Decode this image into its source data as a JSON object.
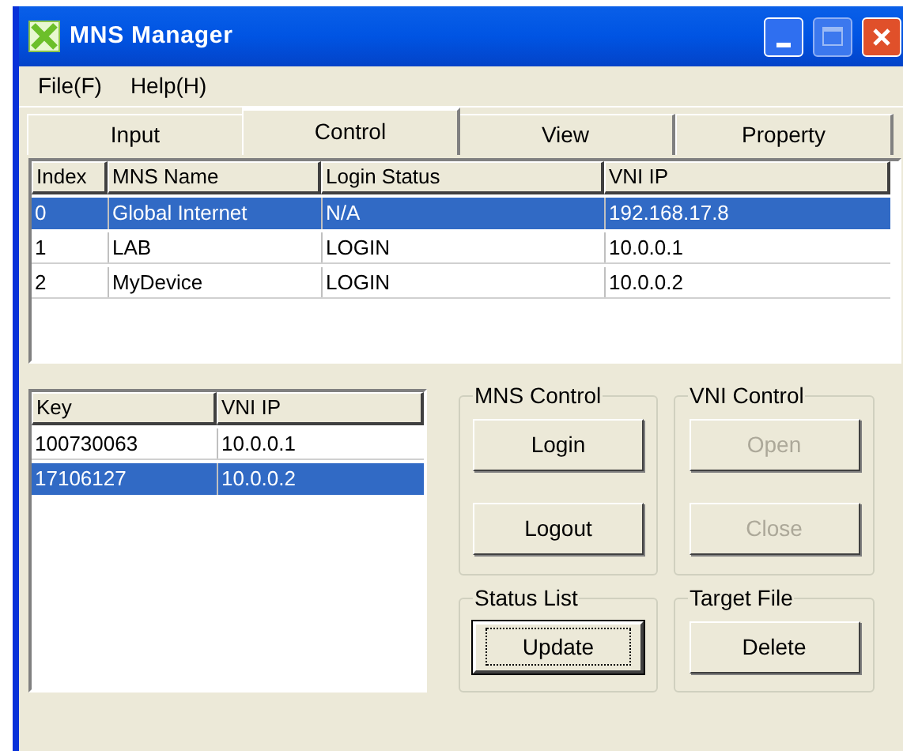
{
  "window": {
    "title": "MNS Manager"
  },
  "menu": [
    "File(F)",
    "Help(H)"
  ],
  "tabs": [
    {
      "label": "Input",
      "selected": false
    },
    {
      "label": "Control",
      "selected": true
    },
    {
      "label": "View",
      "selected": false
    },
    {
      "label": "Property",
      "selected": false
    }
  ],
  "mns_table": {
    "columns": [
      "Index",
      "MNS Name",
      "Login Status",
      "VNI IP"
    ],
    "rows": [
      {
        "cells": [
          "0",
          "Global Internet",
          "N/A",
          "192.168.17.8"
        ],
        "selected": true
      },
      {
        "cells": [
          "1",
          "LAB",
          "LOGIN",
          "10.0.0.1"
        ],
        "selected": false
      },
      {
        "cells": [
          "2",
          "MyDevice",
          "LOGIN",
          "10.0.0.2"
        ],
        "selected": false
      }
    ]
  },
  "key_table": {
    "columns": [
      "Key",
      "VNI IP"
    ],
    "rows": [
      {
        "cells": [
          "100730063",
          "10.0.0.1"
        ],
        "selected": false
      },
      {
        "cells": [
          "17106127",
          "10.0.0.2"
        ],
        "selected": true
      }
    ]
  },
  "groups": [
    {
      "title": "MNS Control",
      "buttons": [
        {
          "label": "Login",
          "disabled": false,
          "focused": false
        },
        {
          "label": "Logout",
          "disabled": false,
          "focused": false
        }
      ]
    },
    {
      "title": "VNI Control",
      "buttons": [
        {
          "label": "Open",
          "disabled": true,
          "focused": false
        },
        {
          "label": "Close",
          "disabled": true,
          "focused": false
        }
      ]
    },
    {
      "title": "Status List",
      "buttons": [
        {
          "label": "Update",
          "disabled": false,
          "focused": true
        }
      ]
    },
    {
      "title": "Target File",
      "buttons": [
        {
          "label": "Delete",
          "disabled": false,
          "focused": false
        }
      ]
    }
  ]
}
